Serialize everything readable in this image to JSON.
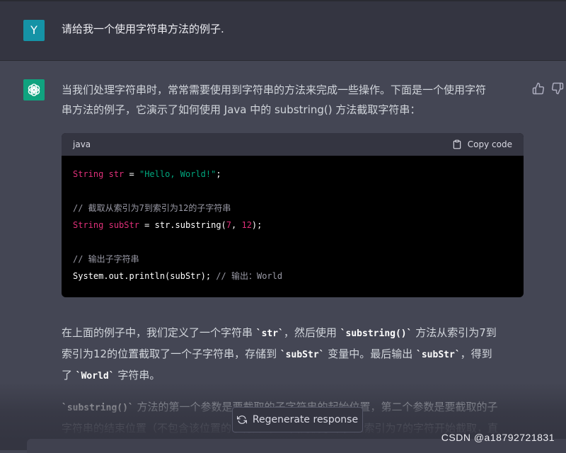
{
  "user": {
    "avatar_letter": "Y",
    "message": "请给我一个使用字符串方法的例子."
  },
  "assistant": {
    "intro": [
      "当我们处理字符串时，常常需要使用到字符串的方法来完成一些操作。下面是一个使用字符",
      "串方法的例子，它演示了如何使用 Java 中的 substring() 方法截取字符串："
    ],
    "code": {
      "language": "java",
      "copy_label": "Copy code",
      "lines": [
        {
          "parts": [
            {
              "t": "String",
              "c": "type"
            },
            {
              "t": " "
            },
            {
              "t": "str",
              "c": "type"
            },
            {
              "t": " = "
            },
            {
              "t": "\"Hello, World!\"",
              "c": "str"
            },
            {
              "t": ";"
            }
          ]
        },
        {
          "parts": []
        },
        {
          "parts": [
            {
              "t": "// 截取从索引为7到索引为12的子字符串",
              "c": "com"
            }
          ]
        },
        {
          "parts": [
            {
              "t": "String",
              "c": "type"
            },
            {
              "t": " "
            },
            {
              "t": "subStr",
              "c": "type"
            },
            {
              "t": " = str.substring("
            },
            {
              "t": "7",
              "c": "num"
            },
            {
              "t": ", "
            },
            {
              "t": "12",
              "c": "num"
            },
            {
              "t": ");"
            }
          ]
        },
        {
          "parts": []
        },
        {
          "parts": [
            {
              "t": "// 输出子字符串",
              "c": "com"
            }
          ]
        },
        {
          "parts": [
            {
              "t": "System.out.println(subStr); "
            },
            {
              "t": "// 输出：World",
              "c": "com"
            }
          ]
        }
      ]
    },
    "explain": [
      [
        {
          "t": "在上面的例子中，我们定义了一个字符串 "
        },
        {
          "t": "`str`",
          "code": true
        },
        {
          "t": "，然后使用 "
        },
        {
          "t": "`substring()`",
          "code": true
        },
        {
          "t": " 方法从索引为7到"
        }
      ],
      [
        {
          "t": "索引为12的位置截取了一个子字符串，存储到 "
        },
        {
          "t": "`subStr`",
          "code": true
        },
        {
          "t": " 变量中。最后输出 "
        },
        {
          "t": "`subStr`",
          "code": true
        },
        {
          "t": "，得到"
        }
      ],
      [
        {
          "t": "了 "
        },
        {
          "t": "`World`",
          "code": true
        },
        {
          "t": " 字符串。"
        }
      ]
    ],
    "explain2": [
      [
        {
          "t": "`substring()`",
          "code": true
        },
        {
          "t": " 方法的第一个参数是要截取的子字符串的起始位置，第二个参数是要截取的子"
        }
      ],
      [
        {
          "t": "字符串的结束位置（不包含该位置的字符）。在上面的例子中，从索引为7的字符开始截取，直"
        }
      ]
    ]
  },
  "regenerate_label": "Regenerate response",
  "watermark": "CSDN @a18792721831",
  "colors": {
    "bot_avatar": "#10a37f",
    "user_avatar": "#1593a6",
    "background": "#444654",
    "code_background": "#000000"
  }
}
